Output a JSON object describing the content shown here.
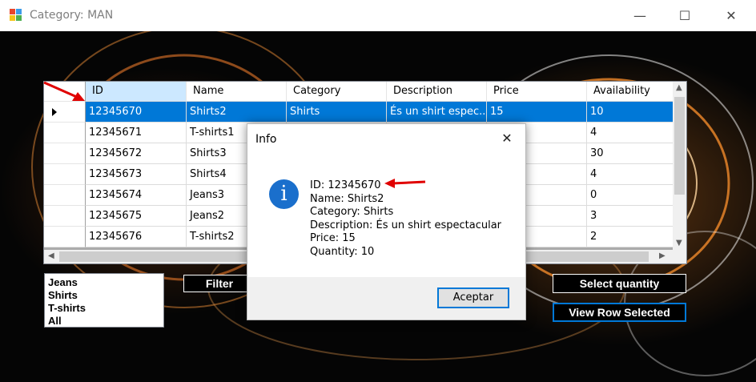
{
  "window": {
    "title": "Category: MAN",
    "minimize": "—",
    "maximize": "☐",
    "close": "✕"
  },
  "grid": {
    "columns": [
      "ID",
      "Name",
      "Category",
      "Description",
      "Price",
      "Availability"
    ],
    "rows": [
      [
        "12345670",
        "Shirts2",
        "Shirts",
        "És un shirt espec...",
        "15",
        "10"
      ],
      [
        "12345671",
        "T-shirts1",
        "",
        "",
        "",
        "4"
      ],
      [
        "12345672",
        "Shirts3",
        "",
        "",
        "",
        "30"
      ],
      [
        "12345673",
        "Shirts4",
        "",
        "",
        "",
        "4"
      ],
      [
        "12345674",
        "Jeans3",
        "",
        "",
        "",
        "0"
      ],
      [
        "12345675",
        "Jeans2",
        "",
        "",
        "",
        "3"
      ],
      [
        "12345676",
        "T-shirts2",
        "",
        "",
        "",
        "2"
      ]
    ],
    "selected_row": 0
  },
  "listbox": {
    "items": [
      "Jeans",
      "Shirts",
      "T-shirts",
      "All"
    ]
  },
  "buttons": {
    "filter": "Filter",
    "select_quantity": "Select quantity",
    "view_row_selected": "View Row Selected"
  },
  "dialog": {
    "title": "Info",
    "close": "✕",
    "icon": "i",
    "lines": [
      "ID: 12345670",
      "Name: Shirts2",
      "Category: Shirts",
      "Description: És un shirt espectacular",
      "Price: 15",
      "Quantity: 10"
    ],
    "ok_label": "Aceptar"
  },
  "colors": {
    "selection": "#0078d7",
    "annotation_arrow": "#e00000",
    "info_icon": "#1a6fcc"
  }
}
